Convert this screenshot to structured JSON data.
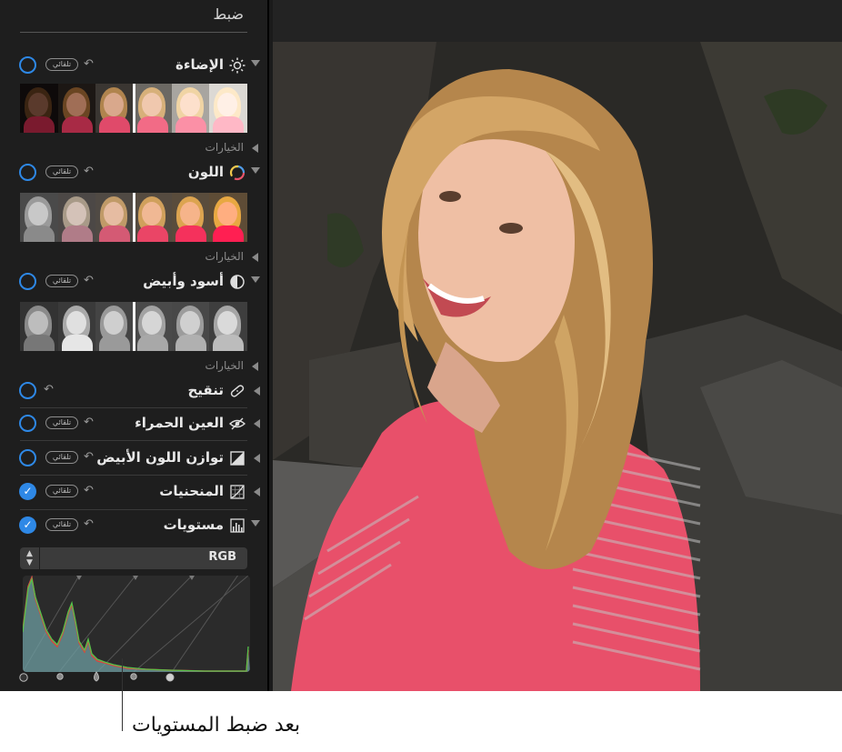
{
  "sidebar": {
    "title": "ضبط",
    "options_label": "الخيارات",
    "auto_label": "تلقائي",
    "sections": [
      {
        "label": "الإضاءة",
        "icon": "sun-icon",
        "has_auto": true,
        "state": "off",
        "expanded": true
      },
      {
        "label": "اللون",
        "icon": "color-wheel-icon",
        "has_auto": true,
        "state": "off",
        "expanded": true
      },
      {
        "label": "أسود وأبيض",
        "icon": "half-circle-icon",
        "has_auto": true,
        "state": "off",
        "expanded": true
      },
      {
        "label": "تنقيح",
        "icon": "bandage-icon",
        "has_auto": false,
        "state": "off",
        "expanded": false
      },
      {
        "label": "العين الحمراء",
        "icon": "eye-slash-icon",
        "has_auto": true,
        "state": "off",
        "expanded": false
      },
      {
        "label": "توازن اللون الأبيض",
        "icon": "white-balance-icon",
        "has_auto": true,
        "state": "off",
        "expanded": false
      },
      {
        "label": "المنحنيات",
        "icon": "curves-icon",
        "has_auto": true,
        "state": "on",
        "expanded": false
      },
      {
        "label": "مستويات",
        "icon": "levels-icon",
        "has_auto": true,
        "state": "on",
        "expanded": true
      }
    ],
    "channel_select": {
      "value": "RGB"
    }
  },
  "caption": "بعد ضبط المستويات",
  "colors": {
    "accent": "#2e88e6",
    "panel": "#1e1e1e",
    "shirt": "#e8506a"
  }
}
